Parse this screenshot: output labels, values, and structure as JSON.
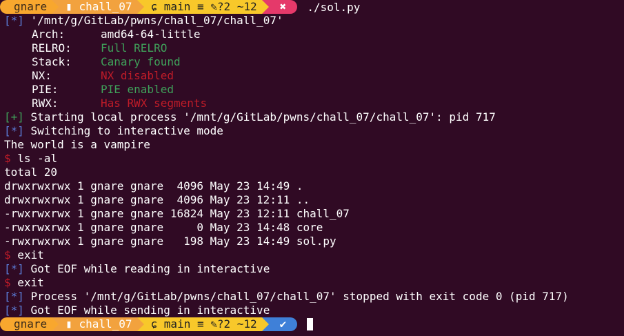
{
  "prompt": {
    "user": "gnare",
    "dir": "chall_07",
    "git_branch": "main",
    "git_status": "≡ ",
    "git_changes": "?2 ~12",
    "last_status_bad": "✖",
    "last_status_ok": "✔",
    "command": "./sol.py",
    "folder_icon": "folder-icon",
    "git_icon": "git-branch-icon",
    "edit_icon": "edit-icon"
  },
  "output": {
    "line1_prefix": "[*]",
    "line1_text": " '/mnt/g/GitLab/pwns/chall_07/chall_07'",
    "checksec": [
      {
        "key": "Arch:",
        "value": "amd64-64-little",
        "color": "white"
      },
      {
        "key": "RELRO:",
        "value": "Full RELRO",
        "color": "green"
      },
      {
        "key": "Stack:",
        "value": "Canary found",
        "color": "green"
      },
      {
        "key": "NX:",
        "value": "NX disabled",
        "color": "red"
      },
      {
        "key": "PIE:",
        "value": "PIE enabled",
        "color": "green"
      },
      {
        "key": "RWX:",
        "value": "Has RWX segments",
        "color": "red"
      }
    ],
    "start_prefix": "[+]",
    "start_text": " Starting local process '/mnt/g/GitLab/pwns/chall_07/chall_07': pid 717",
    "switch_prefix": "[*]",
    "switch_text": " Switching to interactive mode",
    "world": "The world is a vampire",
    "ls_cmd": " ls -al",
    "total": "total 20",
    "ls_lines": [
      "drwxrwxrwx 1 gnare gnare  4096 May 23 14:49 .",
      "drwxrwxrwx 1 gnare gnare  4096 May 23 12:11 ..",
      "-rwxrwxrwx 1 gnare gnare 16824 May 23 12:11 chall_07",
      "-rwxrwxrwx 1 gnare gnare     0 May 23 14:48 core",
      "-rwxrwxrwx 1 gnare gnare   198 May 23 14:49 sol.py"
    ],
    "exit1": " exit",
    "eof_read_prefix": "[*]",
    "eof_read": " Got EOF while reading in interactive",
    "exit2": " exit",
    "stopped_prefix": "[*]",
    "stopped": " Process '/mnt/g/GitLab/pwns/chall_07/chall_07' stopped with exit code 0 (pid 717)",
    "eof_send_prefix": "[*]",
    "eof_send": " Got EOF while sending in interactive",
    "dollar": "$"
  }
}
